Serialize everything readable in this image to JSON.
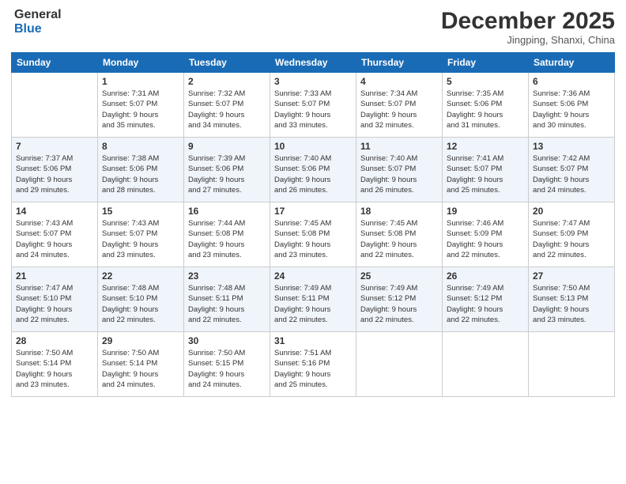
{
  "logo": {
    "line1": "General",
    "line2": "Blue"
  },
  "title": "December 2025",
  "location": "Jingping, Shanxi, China",
  "weekdays": [
    "Sunday",
    "Monday",
    "Tuesday",
    "Wednesday",
    "Thursday",
    "Friday",
    "Saturday"
  ],
  "weeks": [
    [
      {
        "day": "",
        "info": ""
      },
      {
        "day": "1",
        "info": "Sunrise: 7:31 AM\nSunset: 5:07 PM\nDaylight: 9 hours\nand 35 minutes."
      },
      {
        "day": "2",
        "info": "Sunrise: 7:32 AM\nSunset: 5:07 PM\nDaylight: 9 hours\nand 34 minutes."
      },
      {
        "day": "3",
        "info": "Sunrise: 7:33 AM\nSunset: 5:07 PM\nDaylight: 9 hours\nand 33 minutes."
      },
      {
        "day": "4",
        "info": "Sunrise: 7:34 AM\nSunset: 5:07 PM\nDaylight: 9 hours\nand 32 minutes."
      },
      {
        "day": "5",
        "info": "Sunrise: 7:35 AM\nSunset: 5:06 PM\nDaylight: 9 hours\nand 31 minutes."
      },
      {
        "day": "6",
        "info": "Sunrise: 7:36 AM\nSunset: 5:06 PM\nDaylight: 9 hours\nand 30 minutes."
      }
    ],
    [
      {
        "day": "7",
        "info": "Sunrise: 7:37 AM\nSunset: 5:06 PM\nDaylight: 9 hours\nand 29 minutes."
      },
      {
        "day": "8",
        "info": "Sunrise: 7:38 AM\nSunset: 5:06 PM\nDaylight: 9 hours\nand 28 minutes."
      },
      {
        "day": "9",
        "info": "Sunrise: 7:39 AM\nSunset: 5:06 PM\nDaylight: 9 hours\nand 27 minutes."
      },
      {
        "day": "10",
        "info": "Sunrise: 7:40 AM\nSunset: 5:06 PM\nDaylight: 9 hours\nand 26 minutes."
      },
      {
        "day": "11",
        "info": "Sunrise: 7:40 AM\nSunset: 5:07 PM\nDaylight: 9 hours\nand 26 minutes."
      },
      {
        "day": "12",
        "info": "Sunrise: 7:41 AM\nSunset: 5:07 PM\nDaylight: 9 hours\nand 25 minutes."
      },
      {
        "day": "13",
        "info": "Sunrise: 7:42 AM\nSunset: 5:07 PM\nDaylight: 9 hours\nand 24 minutes."
      }
    ],
    [
      {
        "day": "14",
        "info": "Sunrise: 7:43 AM\nSunset: 5:07 PM\nDaylight: 9 hours\nand 24 minutes."
      },
      {
        "day": "15",
        "info": "Sunrise: 7:43 AM\nSunset: 5:07 PM\nDaylight: 9 hours\nand 23 minutes."
      },
      {
        "day": "16",
        "info": "Sunrise: 7:44 AM\nSunset: 5:08 PM\nDaylight: 9 hours\nand 23 minutes."
      },
      {
        "day": "17",
        "info": "Sunrise: 7:45 AM\nSunset: 5:08 PM\nDaylight: 9 hours\nand 23 minutes."
      },
      {
        "day": "18",
        "info": "Sunrise: 7:45 AM\nSunset: 5:08 PM\nDaylight: 9 hours\nand 22 minutes."
      },
      {
        "day": "19",
        "info": "Sunrise: 7:46 AM\nSunset: 5:09 PM\nDaylight: 9 hours\nand 22 minutes."
      },
      {
        "day": "20",
        "info": "Sunrise: 7:47 AM\nSunset: 5:09 PM\nDaylight: 9 hours\nand 22 minutes."
      }
    ],
    [
      {
        "day": "21",
        "info": "Sunrise: 7:47 AM\nSunset: 5:10 PM\nDaylight: 9 hours\nand 22 minutes."
      },
      {
        "day": "22",
        "info": "Sunrise: 7:48 AM\nSunset: 5:10 PM\nDaylight: 9 hours\nand 22 minutes."
      },
      {
        "day": "23",
        "info": "Sunrise: 7:48 AM\nSunset: 5:11 PM\nDaylight: 9 hours\nand 22 minutes."
      },
      {
        "day": "24",
        "info": "Sunrise: 7:49 AM\nSunset: 5:11 PM\nDaylight: 9 hours\nand 22 minutes."
      },
      {
        "day": "25",
        "info": "Sunrise: 7:49 AM\nSunset: 5:12 PM\nDaylight: 9 hours\nand 22 minutes."
      },
      {
        "day": "26",
        "info": "Sunrise: 7:49 AM\nSunset: 5:12 PM\nDaylight: 9 hours\nand 22 minutes."
      },
      {
        "day": "27",
        "info": "Sunrise: 7:50 AM\nSunset: 5:13 PM\nDaylight: 9 hours\nand 23 minutes."
      }
    ],
    [
      {
        "day": "28",
        "info": "Sunrise: 7:50 AM\nSunset: 5:14 PM\nDaylight: 9 hours\nand 23 minutes."
      },
      {
        "day": "29",
        "info": "Sunrise: 7:50 AM\nSunset: 5:14 PM\nDaylight: 9 hours\nand 24 minutes."
      },
      {
        "day": "30",
        "info": "Sunrise: 7:50 AM\nSunset: 5:15 PM\nDaylight: 9 hours\nand 24 minutes."
      },
      {
        "day": "31",
        "info": "Sunrise: 7:51 AM\nSunset: 5:16 PM\nDaylight: 9 hours\nand 25 minutes."
      },
      {
        "day": "",
        "info": ""
      },
      {
        "day": "",
        "info": ""
      },
      {
        "day": "",
        "info": ""
      }
    ]
  ]
}
